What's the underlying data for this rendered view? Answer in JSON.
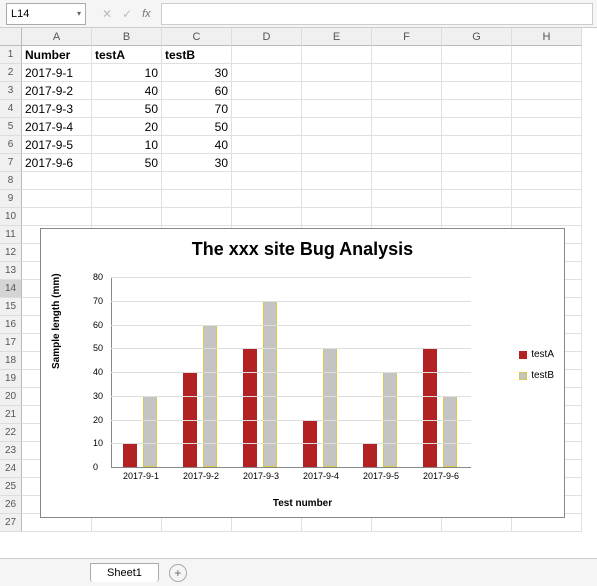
{
  "formula_bar": {
    "cell_ref": "L14",
    "fx_label": "fx"
  },
  "columns": [
    "A",
    "B",
    "C",
    "D",
    "E",
    "F",
    "G",
    "H"
  ],
  "row_count": 27,
  "selected_row": 14,
  "table": {
    "headers": [
      "Number",
      "testA",
      "testB"
    ],
    "rows": [
      [
        "2017-9-1",
        "10",
        "30"
      ],
      [
        "2017-9-2",
        "40",
        "60"
      ],
      [
        "2017-9-3",
        "50",
        "70"
      ],
      [
        "2017-9-4",
        "20",
        "50"
      ],
      [
        "2017-9-5",
        "10",
        "40"
      ],
      [
        "2017-9-6",
        "50",
        "30"
      ]
    ]
  },
  "chart_data": {
    "type": "bar",
    "title": "The xxx site Bug Analysis",
    "xlabel": "Test number",
    "ylabel": "Sample length (mm)",
    "ylim": [
      0,
      80
    ],
    "yticks": [
      0,
      10,
      20,
      30,
      40,
      50,
      60,
      70,
      80
    ],
    "categories": [
      "2017-9-1",
      "2017-9-2",
      "2017-9-3",
      "2017-9-4",
      "2017-9-5",
      "2017-9-6"
    ],
    "series": [
      {
        "name": "testA",
        "values": [
          10,
          40,
          50,
          20,
          10,
          50
        ]
      },
      {
        "name": "testB",
        "values": [
          30,
          60,
          70,
          50,
          40,
          30
        ]
      }
    ]
  },
  "sheet": {
    "active_tab": "Sheet1",
    "add_label": "+"
  }
}
